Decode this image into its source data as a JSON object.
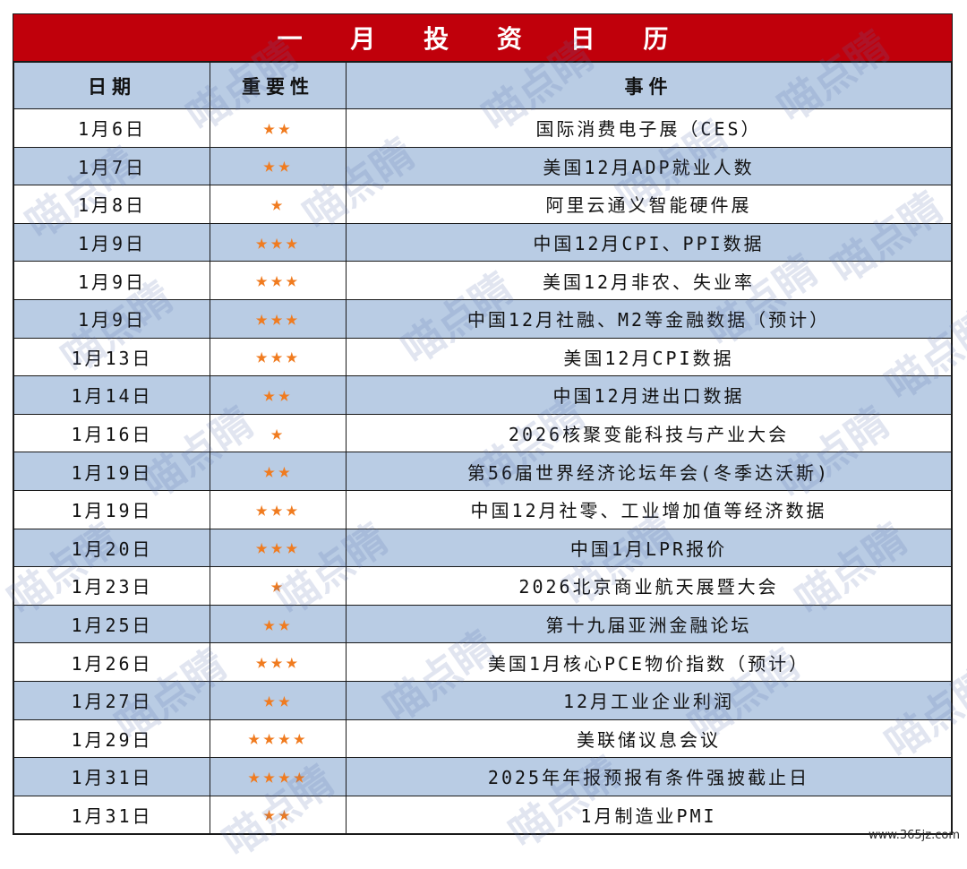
{
  "title": "一 月 投 资 日 历",
  "colors": {
    "title_bg": "#c0000b",
    "band": "#b9cce4",
    "star": "#f07b1f"
  },
  "headers": {
    "date": "日期",
    "importance": "重要性",
    "event": "事件"
  },
  "rows": [
    {
      "date": "1月6日",
      "stars": "★★",
      "event": "国际消费电子展（CES）"
    },
    {
      "date": "1月7日",
      "stars": "★★",
      "event": "美国12月ADP就业人数"
    },
    {
      "date": "1月8日",
      "stars": "★",
      "event": "阿里云通义智能硬件展"
    },
    {
      "date": "1月9日",
      "stars": "★★★",
      "event": "中国12月CPI、PPI数据"
    },
    {
      "date": "1月9日",
      "stars": "★★★",
      "event": "美国12月非农、失业率"
    },
    {
      "date": "1月9日",
      "stars": "★★★",
      "event": "中国12月社融、M2等金融数据（预计）"
    },
    {
      "date": "1月13日",
      "stars": "★★★",
      "event": "美国12月CPI数据"
    },
    {
      "date": "1月14日",
      "stars": "★★",
      "event": "中国12月进出口数据"
    },
    {
      "date": "1月16日",
      "stars": "★",
      "event": "2026核聚变能科技与产业大会"
    },
    {
      "date": "1月19日",
      "stars": "★★",
      "event": "第56届世界经济论坛年会(冬季达沃斯)"
    },
    {
      "date": "1月19日",
      "stars": "★★★",
      "event": "中国12月社零、工业增加值等经济数据"
    },
    {
      "date": "1月20日",
      "stars": "★★★",
      "event": "中国1月LPR报价"
    },
    {
      "date": "1月23日",
      "stars": "★",
      "event": "2026北京商业航天展暨大会"
    },
    {
      "date": "1月25日",
      "stars": "★★",
      "event": "第十九届亚洲金融论坛"
    },
    {
      "date": "1月26日",
      "stars": "★★★",
      "event": "美国1月核心PCE物价指数（预计）"
    },
    {
      "date": "1月27日",
      "stars": "★★",
      "event": "12月工业企业利润"
    },
    {
      "date": "1月29日",
      "stars": "★★★★",
      "event": "美联储议息会议"
    },
    {
      "date": "1月31日",
      "stars": "★★★★",
      "event": "2025年年报预报有条件强披截止日"
    },
    {
      "date": "1月31日",
      "stars": "★★",
      "event": "1月制造业PMI"
    }
  ],
  "watermark": "喵点睛",
  "site_mark": "www.365jz.com"
}
